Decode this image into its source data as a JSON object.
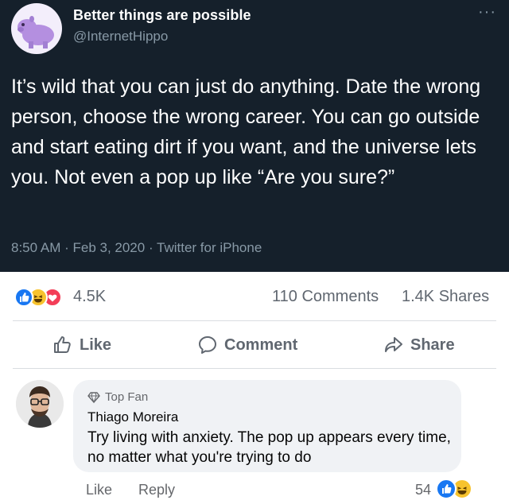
{
  "tweet": {
    "author_name": "Better things are possible",
    "author_handle": "@InternetHippo",
    "more_label": "···",
    "text": "It’s wild that you can just do anything. Date the wrong person, choose the wrong career. You can go outside and start eating dirt if you want, and the universe lets you. Not even a pop up like “Are you sure?”",
    "meta": "8:50 AM · Feb 3, 2020 · Twitter for iPhone"
  },
  "post": {
    "reaction_icons": [
      "like-reaction-icon",
      "haha-reaction-icon",
      "love-reaction-icon"
    ],
    "reaction_count": "4.5K",
    "comments_count": "110 Comments",
    "shares_count": "1.4K Shares",
    "actions": {
      "like": "Like",
      "comment": "Comment",
      "share": "Share"
    }
  },
  "comment": {
    "badge": "Top Fan",
    "author": "Thiago Moreira",
    "text": "Try living with anxiety. The pop up appears every time, no matter what you're trying to do",
    "like_label": "Like",
    "reply_label": "Reply",
    "reaction_count": "54",
    "reaction_icons": [
      "like-reaction-icon",
      "haha-reaction-icon"
    ]
  },
  "colors": {
    "tweet_background": "#15202b",
    "tweet_secondary_text": "#8899a6",
    "facebook_blue": "#1877f2",
    "facebook_gray_text": "#606770",
    "comment_bubble": "#f0f2f5"
  }
}
